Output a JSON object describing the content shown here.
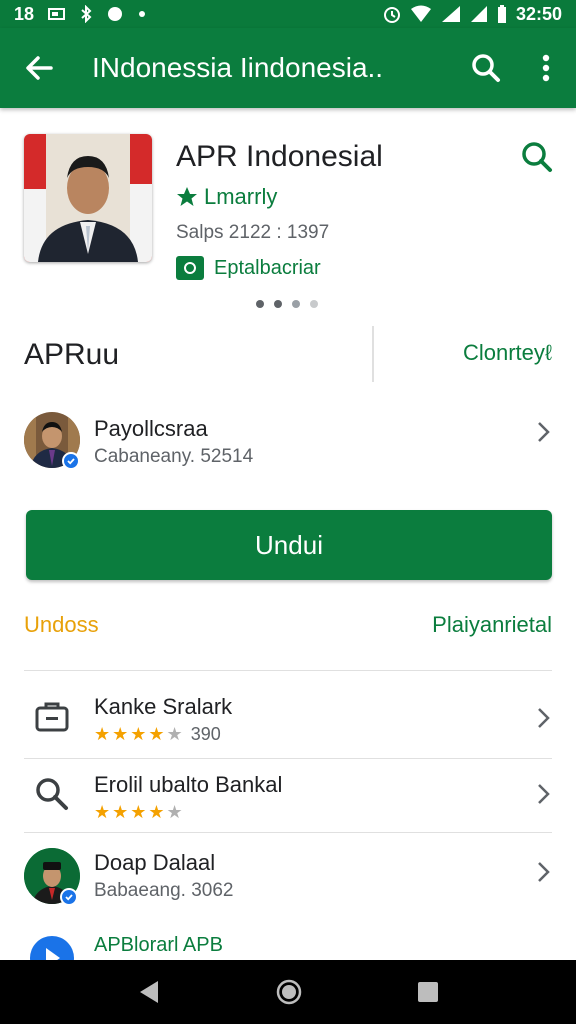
{
  "status_bar": {
    "left_text": "18",
    "time": "32:50"
  },
  "app_bar": {
    "title": "INdonessia Iindonesia.."
  },
  "header": {
    "app_title": "APR Indonesial",
    "category": "Lmarrly",
    "sales": "Salps 2122 : 1397",
    "badge_label": "Eptalbacriar",
    "page_dots": 4,
    "active_dot": 0
  },
  "section": {
    "title": "APRuu",
    "link": "Clonrteyℓ"
  },
  "developer": {
    "name": "Payollcsraa",
    "subtitle": "Cabaneany. 52514"
  },
  "install_button": {
    "label": "Undui"
  },
  "meta": {
    "left": "Undoss",
    "right": "Plaiyanrietal"
  },
  "list": [
    {
      "title": "Kanke Sralark",
      "stars": 4,
      "rating_text": "390",
      "icon": "briefcase-icon"
    },
    {
      "title": "Erolil ubalto Bankal",
      "stars": 4,
      "rating_text": "",
      "icon": "search-icon"
    },
    {
      "title": "Doap Dalaal",
      "subtitle": "Babaeang. 3062",
      "icon": "avatar"
    },
    {
      "title": "APBlorarl APB",
      "icon": "blue-circle-icon"
    }
  ],
  "colors": {
    "brand_green": "#0b7d3e",
    "star": "#f4a100",
    "orange_text": "#e8a10a"
  }
}
